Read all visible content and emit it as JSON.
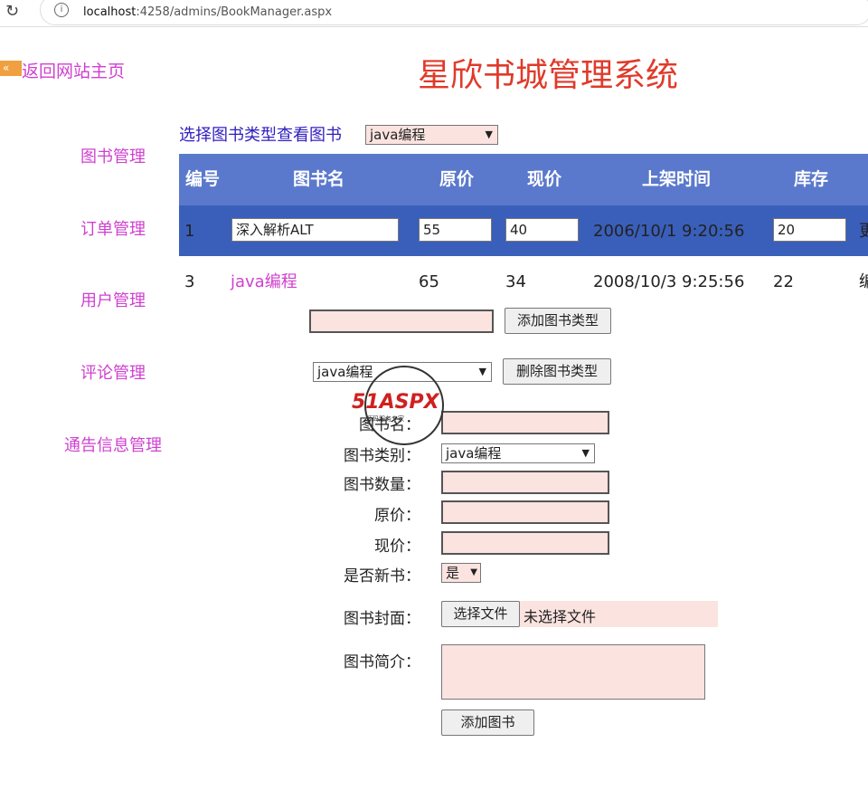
{
  "browser": {
    "url_host": "localhost",
    "url_path": ":4258/admins/BookManager.aspx"
  },
  "back_link": "返回网站主页",
  "title": "星欣书城管理系统",
  "sidebar": [
    "图书管理",
    "订单管理",
    "用户管理",
    "评论管理",
    "通告信息管理"
  ],
  "filter": {
    "label": "选择图书类型查看图书",
    "selected": "java编程"
  },
  "table": {
    "headers": [
      "编号",
      "图书名",
      "原价",
      "现价",
      "上架时间",
      "库存"
    ],
    "rows": [
      {
        "id": "1",
        "name": "深入解析ALT",
        "price": "55",
        "now": "40",
        "time": "2006/10/1 9:20:56",
        "stock": "20",
        "action": "更"
      },
      {
        "id": "3",
        "name": "java编程",
        "price": "65",
        "now": "34",
        "time": "2008/10/3 9:25:56",
        "stock": "22",
        "action": "编"
      }
    ]
  },
  "add_type": {
    "value": "",
    "button": "添加图书类型"
  },
  "del_type": {
    "selected": "java编程",
    "button": "删除图书类型"
  },
  "form": {
    "name_label": "图书名：",
    "type_label": "图书类别：",
    "type_value": "java编程",
    "qty_label": "图书数量：",
    "price_label": "原价：",
    "now_label": "现价：",
    "new_label": "是否新书：",
    "new_value": "是",
    "cover_label": "图书封面：",
    "file_button": "选择文件",
    "file_status": "未选择文件",
    "desc_label": "图书简介：",
    "submit": "添加图书"
  },
  "watermark": {
    "brand": "51ASPX",
    "sub": "源码服务专家"
  }
}
